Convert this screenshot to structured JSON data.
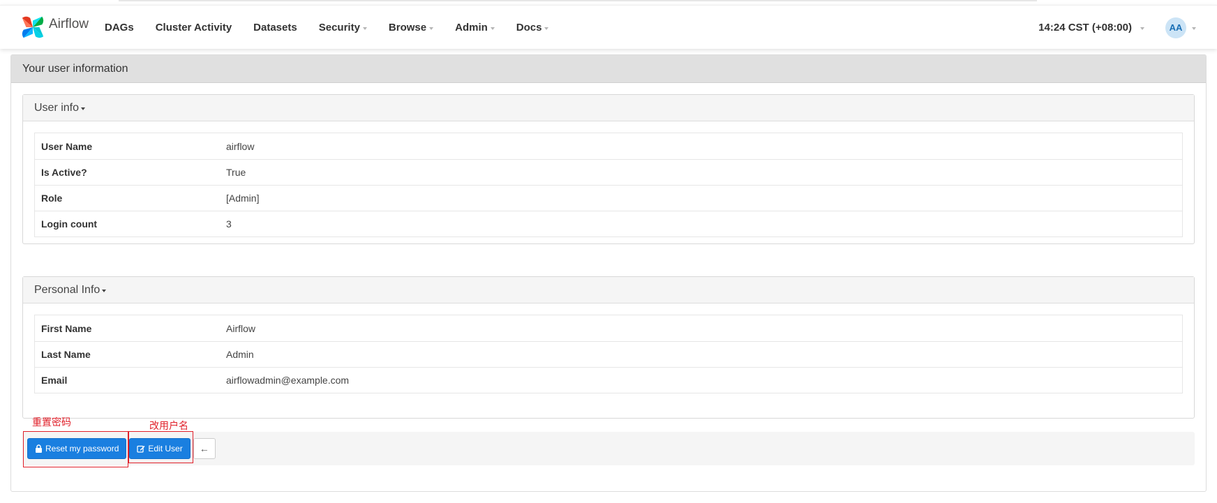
{
  "brand": {
    "name": "Airflow"
  },
  "nav": {
    "items": [
      {
        "label": "DAGs",
        "dropdown": false
      },
      {
        "label": "Cluster Activity",
        "dropdown": false
      },
      {
        "label": "Datasets",
        "dropdown": false
      },
      {
        "label": "Security",
        "dropdown": true
      },
      {
        "label": "Browse",
        "dropdown": true
      },
      {
        "label": "Admin",
        "dropdown": true
      },
      {
        "label": "Docs",
        "dropdown": true
      }
    ],
    "clock": "14:24 CST (+08:00)",
    "avatar_initials": "AA"
  },
  "page": {
    "title": "Your user information"
  },
  "user_info": {
    "heading": "User info",
    "rows": [
      {
        "key": "User Name",
        "value": "airflow"
      },
      {
        "key": "Is Active?",
        "value": "True"
      },
      {
        "key": "Role",
        "value": "[Admin]"
      },
      {
        "key": "Login count",
        "value": "3"
      }
    ]
  },
  "personal_info": {
    "heading": "Personal Info",
    "rows": [
      {
        "key": "First Name",
        "value": "Airflow"
      },
      {
        "key": "Last Name",
        "value": "Admin"
      },
      {
        "key": "Email",
        "value": "airflowadmin@example.com"
      }
    ]
  },
  "actions": {
    "reset_label": "Reset my password",
    "edit_label": "Edit User",
    "back_symbol": "←"
  },
  "annotations": {
    "reset": "重置密码",
    "edit": "改用户名"
  },
  "colors": {
    "primary_button": "#1a7fe0",
    "annotation": "#e0202a",
    "avatar_bg": "#cce4f6"
  },
  "icons": [
    "airflow-logo-icon",
    "lock-icon",
    "edit-icon",
    "arrow-left-icon",
    "caret-down-icon"
  ]
}
